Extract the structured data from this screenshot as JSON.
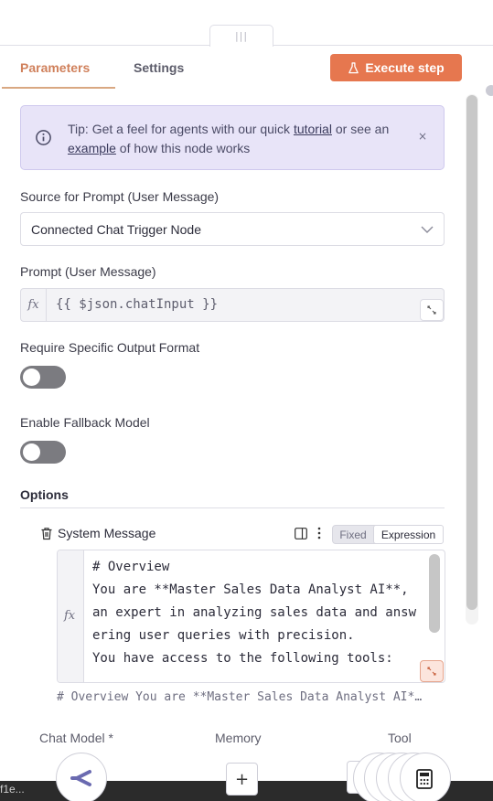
{
  "tabs": {
    "parameters": "Parameters",
    "settings": "Settings"
  },
  "execute_button": "Execute step",
  "tip": {
    "prefix": "Tip: Get a feel for agents with our quick ",
    "tutorial_link": "tutorial",
    "middle": " or see an ",
    "example_link": "example",
    "suffix": " of how this node works",
    "close": "×"
  },
  "fields": {
    "source_label": "Source for Prompt (User Message)",
    "source_value": "Connected Chat Trigger Node",
    "prompt_label": "Prompt (User Message)",
    "prompt_value": "{{ $json.chatInput }}",
    "fx": "fx",
    "require_label": "Require Specific Output Format",
    "fallback_label": "Enable Fallback Model"
  },
  "options": {
    "title": "Options",
    "system_message_label": "System Message",
    "mode_fixed": "Fixed",
    "mode_expression": "Expression",
    "editor_text": "# Overview\nYou are **Master Sales Data Analyst AI**, an expert in analyzing sales data and answering user queries with precision.\nYou have access to the following tools:",
    "preview": "# Overview You are **Master Sales Data Analyst AI*…"
  },
  "footer": {
    "chat_model": "Chat Model *",
    "memory": "Memory",
    "tool": "Tool",
    "plus": "+",
    "bottom_text": "f1e..."
  },
  "colors": {
    "accent": "#e6774f",
    "tab_active": "#d0815c",
    "tip_bg": "#e8e4f8",
    "toggle_off": "#7b7b80"
  },
  "icons": [
    "info-icon",
    "flask-icon",
    "chevron-down-icon",
    "expand-icon",
    "trash-icon",
    "panel-icon",
    "more-vertical-icon",
    "chat-model-icon",
    "calculator-icon"
  ]
}
